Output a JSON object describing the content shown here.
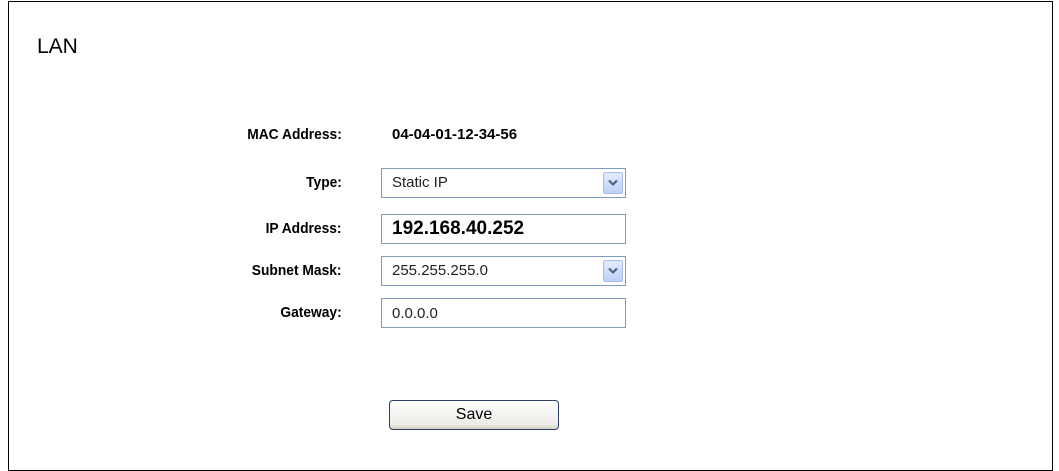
{
  "page": {
    "title": "LAN"
  },
  "form": {
    "mac": {
      "label": "MAC Address:",
      "value": "04-04-01-12-34-56"
    },
    "type": {
      "label": "Type:",
      "value": "Static IP"
    },
    "ip": {
      "label": "IP Address:",
      "value": "192.168.40.252"
    },
    "subnet": {
      "label": "Subnet Mask:",
      "value": "255.255.255.0"
    },
    "gateway": {
      "label": "Gateway:",
      "value": "0.0.0.0"
    }
  },
  "actions": {
    "save_label": "Save"
  },
  "icons": {
    "dropdown": "chevron-down-icon"
  },
  "colors": {
    "field_border": "#7f9db9",
    "dropdown_button": "#c9d9f9",
    "button_border": "#2b3f6c"
  }
}
